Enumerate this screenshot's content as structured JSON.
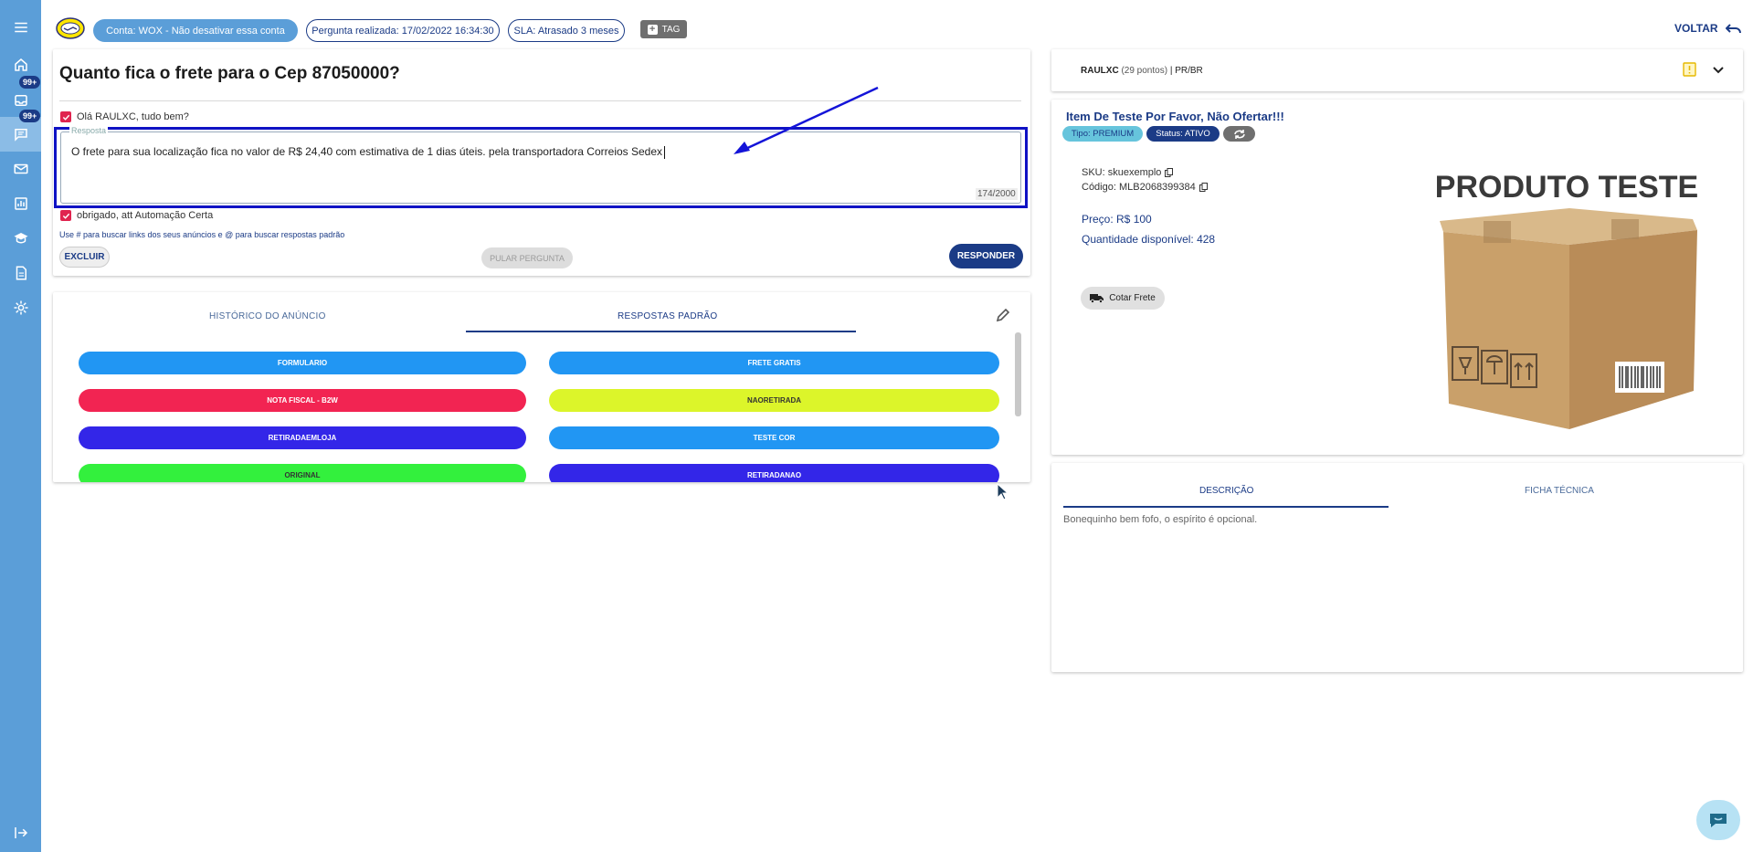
{
  "sidebar": {
    "items": [
      {
        "icon": "menu-icon"
      },
      {
        "icon": "home-icon"
      },
      {
        "icon": "inbox-icon",
        "badge": "99+"
      },
      {
        "icon": "chat-icon",
        "badge": "99+",
        "active": true
      },
      {
        "icon": "mail-icon"
      },
      {
        "icon": "chart-icon"
      },
      {
        "icon": "school-icon"
      },
      {
        "icon": "document-icon"
      },
      {
        "icon": "settings-icon"
      },
      {
        "icon": "logout-icon"
      }
    ]
  },
  "topbar": {
    "account_label": "Conta: WOX - Não desativar essa conta",
    "asked_label": "Pergunta realizada: 17/02/2022 16:34:30",
    "sla_label": "SLA: Atrasado 3 meses",
    "tag_label": "TAG",
    "back_label": "VOLTAR"
  },
  "question": {
    "title": "Quanto fica o frete para o Cep 87050000?",
    "greeting": "Olá RAULXC, tudo bem?",
    "answer_legend": "Resposta",
    "answer_text": "O frete para sua localização fica no valor de R$ 24,40 com estimativa de 1 dias úteis. pela transportadora  Correios Sedex",
    "char_count": "174/2000",
    "signature": "obrigado, att Automação Certa",
    "hint": "Use # para buscar links dos seus anúncios e @ para buscar respostas padrão",
    "delete_label": "EXCLUIR",
    "skip_label": "PULAR PERGUNTA",
    "reply_label": "RESPONDER"
  },
  "tabs": {
    "history_label": "HISTÓRICO DO ANÚNCIO",
    "standard_label": "RESPOSTAS PADRÃO"
  },
  "standard_answers": [
    {
      "label": "FORMULARIO",
      "color": "#2196f3",
      "text_color": "#ffffff"
    },
    {
      "label": "FRETE GRATIS",
      "color": "#2196f3",
      "text_color": "#ffffff"
    },
    {
      "label": "NOTA FISCAL - B2W",
      "color": "#f22452",
      "text_color": "#ffffff"
    },
    {
      "label": "NAORETIRADA",
      "color": "#dcf52a",
      "text_color": "#333333"
    },
    {
      "label": "RETIRADAEMLOJA",
      "color": "#3326e8",
      "text_color": "#ffffff"
    },
    {
      "label": "TESTE COR",
      "color": "#2196f3",
      "text_color": "#ffffff"
    },
    {
      "label": "ORIGINAL",
      "color": "#33f03d",
      "text_color": "#333333"
    },
    {
      "label": "RETIRADANAO",
      "color": "#3326e8",
      "text_color": "#ffffff"
    }
  ],
  "customer": {
    "name": "RAULXC",
    "points": "(29 pontos)",
    "location": "| PR/BR"
  },
  "item": {
    "title": "Item De Teste Por Favor, Não Ofertar!!!",
    "type_label": "Tipo: PREMIUM",
    "status_label": "Status: ATIVO",
    "sku": "SKU: skuexemplo",
    "code": "Código: MLB2068399384",
    "price": "Preço: R$ 100",
    "quantity": "Quantidade disponível: 428",
    "shipping_label": "Cotar Frete",
    "image_text": "PRODUTO TESTE"
  },
  "details": {
    "description_tab": "DESCRIÇÃO",
    "specs_tab": "FICHA TÉCNICA",
    "description_text": "Bonequinho bem fofo, o espírito é opcional."
  },
  "colors": {
    "sidebar": "#5b9ed8",
    "primary": "#1b3b86",
    "accent_red": "#e0244f",
    "highlight_frame": "#0f12c4"
  }
}
